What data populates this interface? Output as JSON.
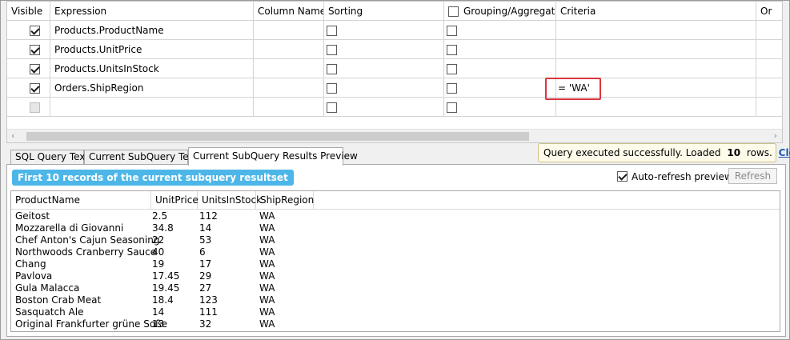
{
  "grid": {
    "headers": [
      "Visible",
      "Expression",
      "Column Name",
      "Sorting",
      "Grouping/Aggregate",
      "Criteria",
      "Or"
    ],
    "rows": [
      {
        "visible": true,
        "expression": "Products.ProductName",
        "criteria": ""
      },
      {
        "visible": true,
        "expression": "Products.UnitPrice",
        "criteria": ""
      },
      {
        "visible": true,
        "expression": "Products.UnitsInStock",
        "criteria": ""
      },
      {
        "visible": true,
        "expression": "Orders.ShipRegion",
        "criteria": "= 'WA'"
      },
      {
        "visible": false,
        "expression": "",
        "criteria": ""
      }
    ]
  },
  "tabs": [
    "SQL Query Text",
    "Current SubQuery Text",
    "Current SubQuery Results Preview"
  ],
  "preview": {
    "badge": "First 10 records of the current subquery resultset",
    "auto_refresh_label": "Auto-refresh preview",
    "refresh_label": "Refresh",
    "columns": [
      "ProductName",
      "UnitPrice",
      "UnitsInStock",
      "ShipRegion"
    ],
    "rows": [
      [
        "Geitost",
        "2.5",
        "112",
        "WA"
      ],
      [
        "Mozzarella di Giovanni",
        "34.8",
        "14",
        "WA"
      ],
      [
        "Chef Anton's Cajun Seasoning",
        "22",
        "53",
        "WA"
      ],
      [
        "Northwoods Cranberry Sauce",
        "40",
        "6",
        "WA"
      ],
      [
        "Chang",
        "19",
        "17",
        "WA"
      ],
      [
        "Pavlova",
        "17.45",
        "29",
        "WA"
      ],
      [
        "Gula Malacca",
        "19.45",
        "27",
        "WA"
      ],
      [
        "Boston Crab Meat",
        "18.4",
        "123",
        "WA"
      ],
      [
        "Sasquatch Ale",
        "14",
        "111",
        "WA"
      ],
      [
        "Original Frankfurter grüne Soße",
        "13",
        "32",
        "WA"
      ]
    ]
  },
  "toast": {
    "prefix": "Query executed successfully. Loaded",
    "count": "10",
    "suffix": "rows.",
    "close_label": "Close"
  },
  "colors": {
    "badge": "#4db6e8",
    "highlight": "#d9363e",
    "link": "#1a5cb8"
  }
}
